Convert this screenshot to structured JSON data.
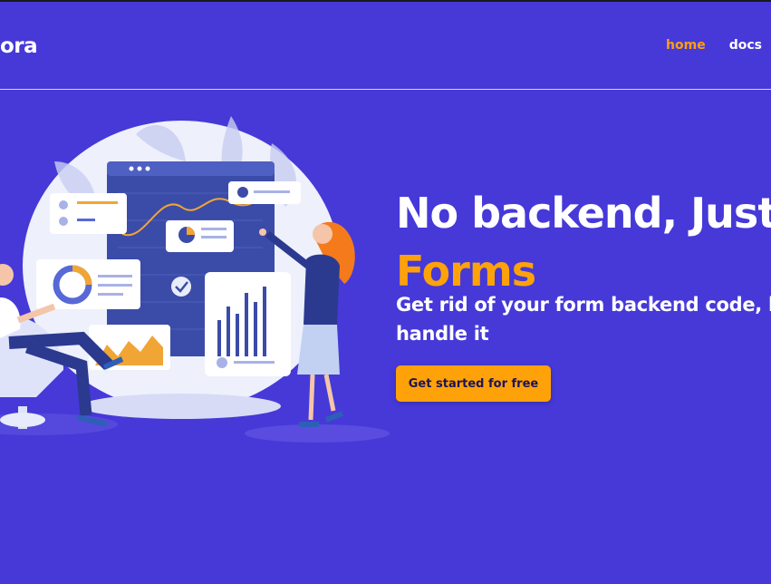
{
  "nav": {
    "brand": "ora",
    "links": [
      {
        "label": "home",
        "active": true
      },
      {
        "label": "docs",
        "active": false
      }
    ]
  },
  "hero": {
    "title_line1": "No backend, Just",
    "title_line2": "Forms",
    "subtitle_line1": "Get rid of your form backend code, l",
    "subtitle_line2": "handle it",
    "cta_label": "Get started for free"
  },
  "colors": {
    "background": "#4639d8",
    "accent": "#ffa20a",
    "text": "#ffffff"
  }
}
